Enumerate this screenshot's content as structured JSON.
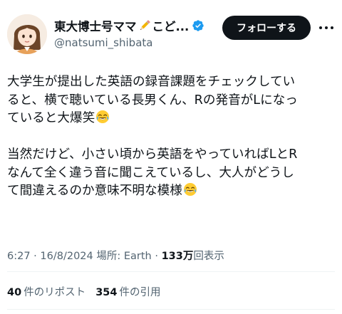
{
  "author": {
    "display_name": "東大博士号ママ",
    "display_name_tail": "こど...",
    "handle": "@natsumi_shibata",
    "verified": true,
    "name_emoji": "pencil-icon",
    "avatar": "avatar-illustration"
  },
  "actions": {
    "follow_label": "フォローする",
    "more_icon": "more-icon"
  },
  "tweet": {
    "para1": {
      "line1": "大学生が提出した英語の録音課題をチェックしてい",
      "line2": "ると、横で聴いている長男くん、Rの発音がLになっ",
      "line3": "ていると大爆笑",
      "emoji": "face-with-tears-of-joy"
    },
    "para2": {
      "line1": "当然だけど、小さい頃から英語をやっていればLとR",
      "line2": "なんて全く違う音に聞こえているし、大人がどうし",
      "line3": "て間違えるのか意味不明な模様",
      "emoji": "face-with-tears-of-joy"
    }
  },
  "meta": {
    "time": "6:27",
    "date": "16/8/2024",
    "location_label": "場所: Earth",
    "views_count": "133万",
    "views_label": "回表示",
    "separator": "·"
  },
  "stats": {
    "reposts_count": "40",
    "reposts_label": "件のリポスト",
    "quotes_count": "354",
    "quotes_label": "件の引用"
  },
  "colors": {
    "text_primary": "#0f1419",
    "text_secondary": "#536471",
    "verified_blue": "#1d9bf0",
    "button_bg": "#0f1419",
    "divider": "#eff3f4"
  }
}
